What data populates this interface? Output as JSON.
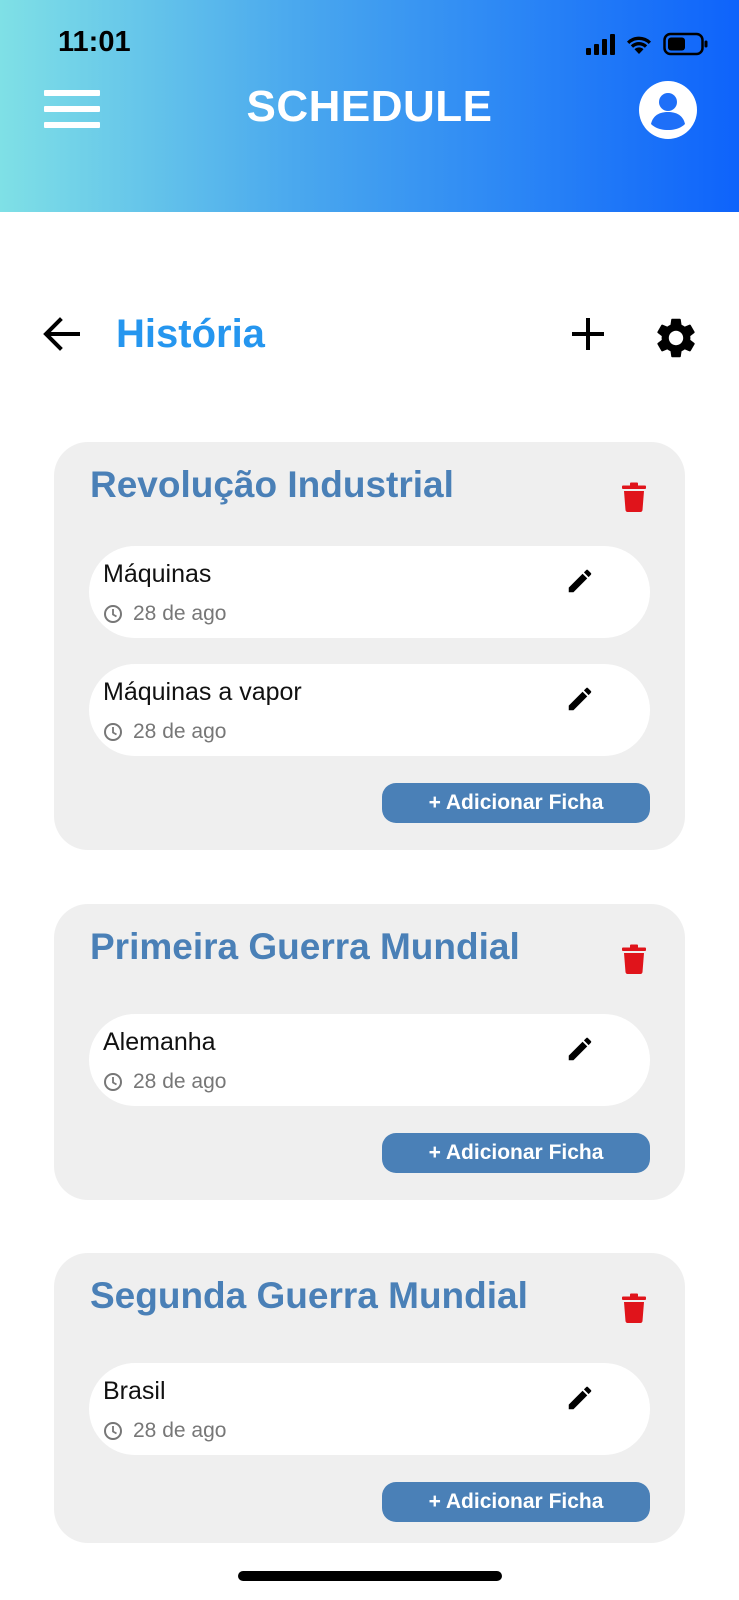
{
  "status_bar": {
    "time": "11:01"
  },
  "header": {
    "title": "SCHEDULE"
  },
  "page": {
    "title": "História"
  },
  "decks": [
    {
      "title": "Revolução Industrial",
      "cards": [
        {
          "title": "Máquinas",
          "date": "28 de ago"
        },
        {
          "title": "Máquinas a vapor",
          "date": "28 de ago"
        }
      ],
      "add_label": "+ Adicionar Ficha"
    },
    {
      "title": "Primeira Guerra Mundial",
      "cards": [
        {
          "title": "Alemanha",
          "date": "28 de ago"
        }
      ],
      "add_label": "+ Adicionar Ficha"
    },
    {
      "title": "Segunda Guerra Mundial",
      "cards": [
        {
          "title": "Brasil",
          "date": "28 de ago"
        }
      ],
      "add_label": "+ Adicionar Ficha"
    }
  ],
  "colors": {
    "accent": "#2596ef",
    "deck_title": "#4a80b7",
    "delete": "#e0141b",
    "deck_bg": "#efefef"
  },
  "icons": {
    "menu": "hamburger-icon",
    "profile": "user-circle-icon",
    "back": "arrow-left-icon",
    "add": "plus-icon",
    "settings": "gear-icon",
    "delete": "trash-icon",
    "edit": "pencil-icon",
    "date": "clock-icon"
  }
}
